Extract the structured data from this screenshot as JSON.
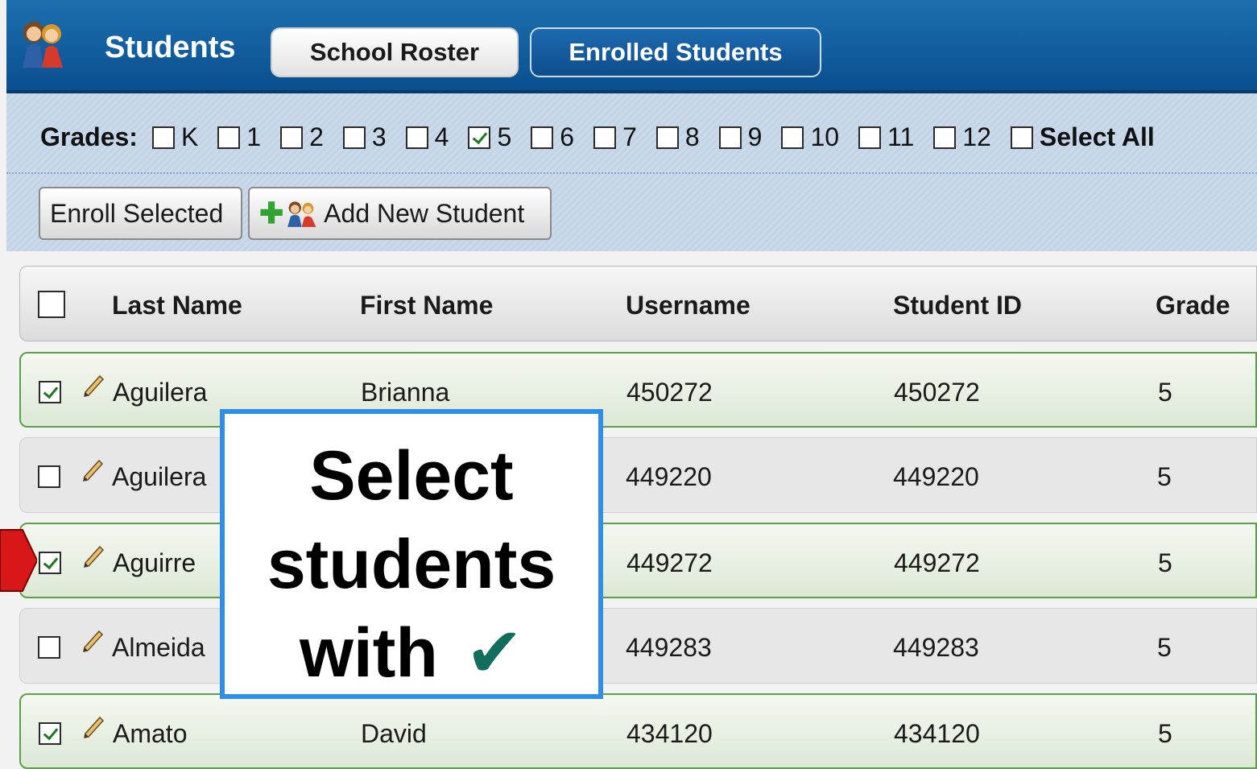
{
  "header": {
    "title": "Students",
    "tabs": [
      {
        "label": "School Roster",
        "active": true
      },
      {
        "label": "Enrolled Students",
        "active": false
      }
    ]
  },
  "filters": {
    "label": "Grades:",
    "grades": [
      {
        "label": "K",
        "checked": false
      },
      {
        "label": "1",
        "checked": false
      },
      {
        "label": "2",
        "checked": false
      },
      {
        "label": "3",
        "checked": false
      },
      {
        "label": "4",
        "checked": false
      },
      {
        "label": "5",
        "checked": true
      },
      {
        "label": "6",
        "checked": false
      },
      {
        "label": "7",
        "checked": false
      },
      {
        "label": "8",
        "checked": false
      },
      {
        "label": "9",
        "checked": false
      },
      {
        "label": "10",
        "checked": false
      },
      {
        "label": "11",
        "checked": false
      },
      {
        "label": "12",
        "checked": false
      }
    ],
    "select_all_label": "Select All"
  },
  "toolbar": {
    "enroll_label": "Enroll Selected",
    "add_label": "Add New Student"
  },
  "table": {
    "columns": [
      "Last Name",
      "First Name",
      "Username",
      "Student ID",
      "Grade"
    ],
    "rows": [
      {
        "checked": true,
        "last": "Aguilera",
        "first": "Brianna",
        "username": "450272",
        "student_id": "450272",
        "grade": "5"
      },
      {
        "checked": false,
        "last": "Aguilera",
        "first": "",
        "username": "449220",
        "student_id": "449220",
        "grade": "5"
      },
      {
        "checked": true,
        "last": "Aguirre",
        "first": "",
        "username": "449272",
        "student_id": "449272",
        "grade": "5"
      },
      {
        "checked": false,
        "last": "Almeida",
        "first": "",
        "username": "449283",
        "student_id": "449283",
        "grade": "5"
      },
      {
        "checked": true,
        "last": "Amato",
        "first": "David",
        "username": "434120",
        "student_id": "434120",
        "grade": "5"
      }
    ]
  },
  "callout": {
    "line1": "Select",
    "line2": "students",
    "line3": "with",
    "mark": "✔"
  },
  "colors": {
    "header_blue": "#0a4f8f",
    "selected_row_border": "#5ba049",
    "callout_border": "#2e8ee8",
    "arrow_red": "#d81818"
  }
}
